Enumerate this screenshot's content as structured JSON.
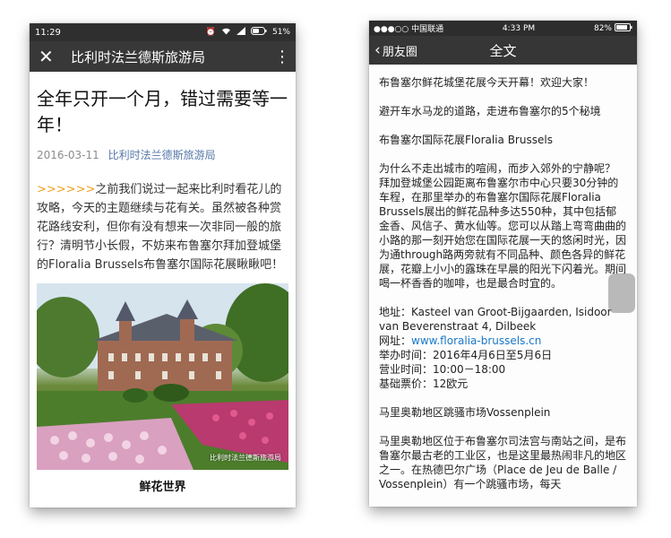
{
  "left": {
    "status": {
      "time": "11:29",
      "battery": "51%"
    },
    "nav": {
      "title": "比利时法兰德斯旅游局"
    },
    "article": {
      "title": "全年只开一个月，错过需要等一年！",
      "date": "2016-03-11",
      "source": "比利时法兰德斯旅游局",
      "arrow": ">>>>>>",
      "intro": "之前我们说过一起来比利时看花儿的攻略，今天的主题继续与花有关。虽然被各种赏花路线安利，但你有没有想来一次非同一般的旅行？清明节小长假，不妨来布鲁塞尔拜加登城堡的Floralia Brussels布鲁塞尔国际花展瞅瞅吧！",
      "image_watermark": "比利时法兰德斯旅游局",
      "caption": "鲜花世界"
    }
  },
  "right": {
    "status": {
      "carrier": "●●●○○ 中国联通",
      "time": "4:33 PM",
      "battery": "82%"
    },
    "nav": {
      "back": "朋友圈",
      "title": "全文"
    },
    "content": {
      "p1": "布鲁塞尔鲜花城堡花展今天开幕！欢迎大家！",
      "p2": "避开车水马龙的道路，走进布鲁塞尔的5个秘境",
      "p3": "布鲁塞尔国际花展Floralia Brussels",
      "p4a": "为什么不走出城市的喧闹，而步入郊外的宁静呢？",
      "p4b": "拜加登城堡公园距离布鲁塞尔市中心只要30分钟的车程，在那里举办的布鲁塞尔国际花展Floralia Brussels展出的鲜花品种多达550种，其中包括郁金香、风信子、黄水仙等。您可以从踏上弯弯曲曲的小路的那一刻开始您在国际花展一天的悠闲时光，因为通through路两旁就有不同品种、颜色各异的鲜花展，花瓣上小小的露珠在早晨的阳光下闪着光。期间喝一杯香香的咖啡，也是最合时宜的。",
      "address": "地址：Kasteel van Groot-Bijgaarden, Isidoor van Beverenstraat 4, Dilbeek",
      "website_label": "网址：",
      "website": "www.floralia-brussels.cn",
      "dates": "举办时间：2016年4月6日至5月6日",
      "hours": "营业时间：10:00－18:00",
      "price": "基础票价：12欧元",
      "p6": "马里奥勒地区跳骚市场Vossenplein",
      "p7": "马里奥勒地区位于布鲁塞尔司法宫与南站之间，是布鲁塞尔最古老的工业区，也是这里最热闹非凡的地区之一。在热德巴尔广场（Place de Jeu de Balle / Vossenplein）有一个跳骚市场，每天"
    }
  }
}
